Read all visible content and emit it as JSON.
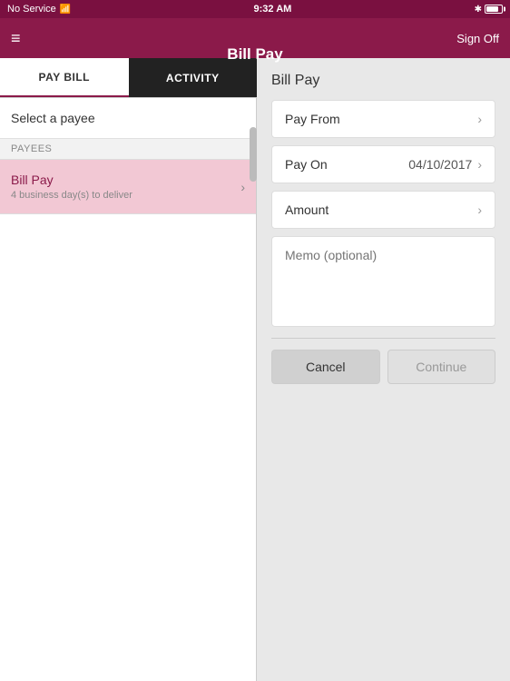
{
  "statusBar": {
    "signal": "No Service",
    "wifi": "wifi",
    "time": "9:32 AM",
    "bluetooth": "BT",
    "battery": "battery"
  },
  "navBar": {
    "menu": "≡",
    "title": "Bill Pay",
    "signOff": "Sign Off"
  },
  "tabs": [
    {
      "id": "pay-bill",
      "label": "PAY BILL",
      "active": true
    },
    {
      "id": "activity",
      "label": "ACTIVITY",
      "active": false
    }
  ],
  "leftPanel": {
    "selectPayeeLabel": "Select a payee",
    "payeesSection": "PAYEES",
    "payees": [
      {
        "name": "Bill Pay",
        "delivery": "4 business day(s) to deliver"
      }
    ]
  },
  "rightPanel": {
    "title": "Bill Pay",
    "fields": [
      {
        "id": "pay-from",
        "label": "Pay From",
        "value": ""
      },
      {
        "id": "pay-on",
        "label": "Pay On",
        "value": "04/10/2017"
      },
      {
        "id": "amount",
        "label": "Amount",
        "value": ""
      }
    ],
    "memo": {
      "label": "Memo (optional)",
      "placeholder": "Memo (optional)"
    },
    "buttons": {
      "cancel": "Cancel",
      "continue": "Continue"
    }
  }
}
